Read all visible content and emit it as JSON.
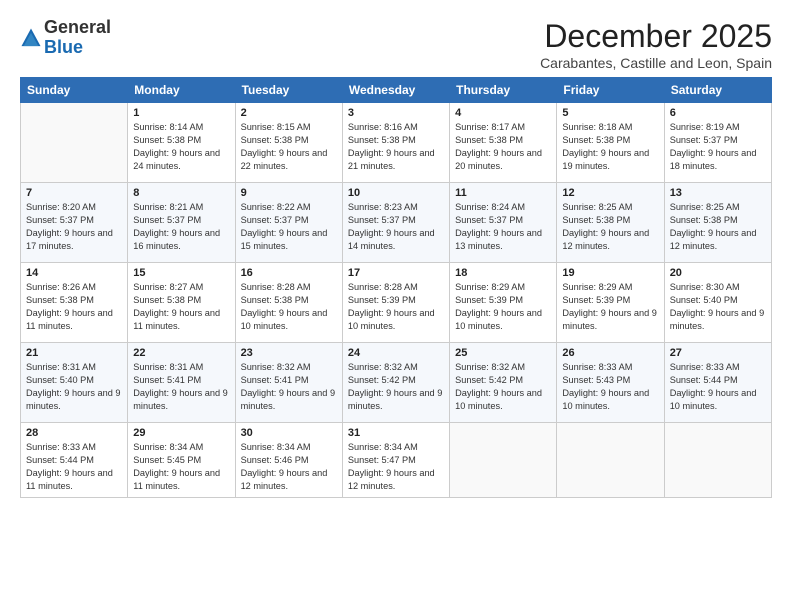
{
  "header": {
    "logo_general": "General",
    "logo_blue": "Blue",
    "month_title": "December 2025",
    "subtitle": "Carabantes, Castille and Leon, Spain"
  },
  "days_of_week": [
    "Sunday",
    "Monday",
    "Tuesday",
    "Wednesday",
    "Thursday",
    "Friday",
    "Saturday"
  ],
  "weeks": [
    [
      {
        "day": "",
        "sunrise": "",
        "sunset": "",
        "daylight": ""
      },
      {
        "day": "1",
        "sunrise": "Sunrise: 8:14 AM",
        "sunset": "Sunset: 5:38 PM",
        "daylight": "Daylight: 9 hours and 24 minutes."
      },
      {
        "day": "2",
        "sunrise": "Sunrise: 8:15 AM",
        "sunset": "Sunset: 5:38 PM",
        "daylight": "Daylight: 9 hours and 22 minutes."
      },
      {
        "day": "3",
        "sunrise": "Sunrise: 8:16 AM",
        "sunset": "Sunset: 5:38 PM",
        "daylight": "Daylight: 9 hours and 21 minutes."
      },
      {
        "day": "4",
        "sunrise": "Sunrise: 8:17 AM",
        "sunset": "Sunset: 5:38 PM",
        "daylight": "Daylight: 9 hours and 20 minutes."
      },
      {
        "day": "5",
        "sunrise": "Sunrise: 8:18 AM",
        "sunset": "Sunset: 5:38 PM",
        "daylight": "Daylight: 9 hours and 19 minutes."
      },
      {
        "day": "6",
        "sunrise": "Sunrise: 8:19 AM",
        "sunset": "Sunset: 5:37 PM",
        "daylight": "Daylight: 9 hours and 18 minutes."
      }
    ],
    [
      {
        "day": "7",
        "sunrise": "Sunrise: 8:20 AM",
        "sunset": "Sunset: 5:37 PM",
        "daylight": "Daylight: 9 hours and 17 minutes."
      },
      {
        "day": "8",
        "sunrise": "Sunrise: 8:21 AM",
        "sunset": "Sunset: 5:37 PM",
        "daylight": "Daylight: 9 hours and 16 minutes."
      },
      {
        "day": "9",
        "sunrise": "Sunrise: 8:22 AM",
        "sunset": "Sunset: 5:37 PM",
        "daylight": "Daylight: 9 hours and 15 minutes."
      },
      {
        "day": "10",
        "sunrise": "Sunrise: 8:23 AM",
        "sunset": "Sunset: 5:37 PM",
        "daylight": "Daylight: 9 hours and 14 minutes."
      },
      {
        "day": "11",
        "sunrise": "Sunrise: 8:24 AM",
        "sunset": "Sunset: 5:37 PM",
        "daylight": "Daylight: 9 hours and 13 minutes."
      },
      {
        "day": "12",
        "sunrise": "Sunrise: 8:25 AM",
        "sunset": "Sunset: 5:38 PM",
        "daylight": "Daylight: 9 hours and 12 minutes."
      },
      {
        "day": "13",
        "sunrise": "Sunrise: 8:25 AM",
        "sunset": "Sunset: 5:38 PM",
        "daylight": "Daylight: 9 hours and 12 minutes."
      }
    ],
    [
      {
        "day": "14",
        "sunrise": "Sunrise: 8:26 AM",
        "sunset": "Sunset: 5:38 PM",
        "daylight": "Daylight: 9 hours and 11 minutes."
      },
      {
        "day": "15",
        "sunrise": "Sunrise: 8:27 AM",
        "sunset": "Sunset: 5:38 PM",
        "daylight": "Daylight: 9 hours and 11 minutes."
      },
      {
        "day": "16",
        "sunrise": "Sunrise: 8:28 AM",
        "sunset": "Sunset: 5:38 PM",
        "daylight": "Daylight: 9 hours and 10 minutes."
      },
      {
        "day": "17",
        "sunrise": "Sunrise: 8:28 AM",
        "sunset": "Sunset: 5:39 PM",
        "daylight": "Daylight: 9 hours and 10 minutes."
      },
      {
        "day": "18",
        "sunrise": "Sunrise: 8:29 AM",
        "sunset": "Sunset: 5:39 PM",
        "daylight": "Daylight: 9 hours and 10 minutes."
      },
      {
        "day": "19",
        "sunrise": "Sunrise: 8:29 AM",
        "sunset": "Sunset: 5:39 PM",
        "daylight": "Daylight: 9 hours and 9 minutes."
      },
      {
        "day": "20",
        "sunrise": "Sunrise: 8:30 AM",
        "sunset": "Sunset: 5:40 PM",
        "daylight": "Daylight: 9 hours and 9 minutes."
      }
    ],
    [
      {
        "day": "21",
        "sunrise": "Sunrise: 8:31 AM",
        "sunset": "Sunset: 5:40 PM",
        "daylight": "Daylight: 9 hours and 9 minutes."
      },
      {
        "day": "22",
        "sunrise": "Sunrise: 8:31 AM",
        "sunset": "Sunset: 5:41 PM",
        "daylight": "Daylight: 9 hours and 9 minutes."
      },
      {
        "day": "23",
        "sunrise": "Sunrise: 8:32 AM",
        "sunset": "Sunset: 5:41 PM",
        "daylight": "Daylight: 9 hours and 9 minutes."
      },
      {
        "day": "24",
        "sunrise": "Sunrise: 8:32 AM",
        "sunset": "Sunset: 5:42 PM",
        "daylight": "Daylight: 9 hours and 9 minutes."
      },
      {
        "day": "25",
        "sunrise": "Sunrise: 8:32 AM",
        "sunset": "Sunset: 5:42 PM",
        "daylight": "Daylight: 9 hours and 10 minutes."
      },
      {
        "day": "26",
        "sunrise": "Sunrise: 8:33 AM",
        "sunset": "Sunset: 5:43 PM",
        "daylight": "Daylight: 9 hours and 10 minutes."
      },
      {
        "day": "27",
        "sunrise": "Sunrise: 8:33 AM",
        "sunset": "Sunset: 5:44 PM",
        "daylight": "Daylight: 9 hours and 10 minutes."
      }
    ],
    [
      {
        "day": "28",
        "sunrise": "Sunrise: 8:33 AM",
        "sunset": "Sunset: 5:44 PM",
        "daylight": "Daylight: 9 hours and 11 minutes."
      },
      {
        "day": "29",
        "sunrise": "Sunrise: 8:34 AM",
        "sunset": "Sunset: 5:45 PM",
        "daylight": "Daylight: 9 hours and 11 minutes."
      },
      {
        "day": "30",
        "sunrise": "Sunrise: 8:34 AM",
        "sunset": "Sunset: 5:46 PM",
        "daylight": "Daylight: 9 hours and 12 minutes."
      },
      {
        "day": "31",
        "sunrise": "Sunrise: 8:34 AM",
        "sunset": "Sunset: 5:47 PM",
        "daylight": "Daylight: 9 hours and 12 minutes."
      },
      {
        "day": "",
        "sunrise": "",
        "sunset": "",
        "daylight": ""
      },
      {
        "day": "",
        "sunrise": "",
        "sunset": "",
        "daylight": ""
      },
      {
        "day": "",
        "sunrise": "",
        "sunset": "",
        "daylight": ""
      }
    ]
  ]
}
